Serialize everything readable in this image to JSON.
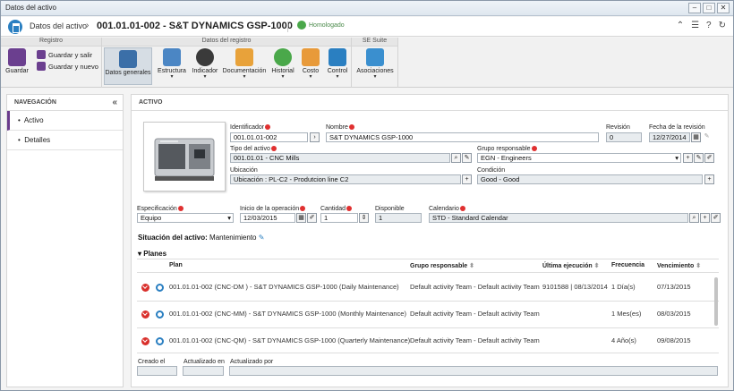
{
  "window": {
    "title": "Datos del activo",
    "buttons": [
      "–",
      "□",
      "✕"
    ]
  },
  "header": {
    "breadcrumb": "Datos del activo",
    "title": "001.01.01-002 - S&T DYNAMICS GSP-1000",
    "badge": "Homologado"
  },
  "ribbon": {
    "groups": [
      {
        "label": "Registro",
        "save": "Guardar",
        "save_exit": "Guardar y salir",
        "save_new": "Guardar y nuevo"
      },
      {
        "label": "Datos del registro",
        "buttons": [
          "Datos generales",
          "Estructura",
          "Indicador",
          "Documentación",
          "Historial",
          "Costo",
          "Control"
        ]
      },
      {
        "label": "SE Suite",
        "buttons": [
          "Asociaciones"
        ]
      }
    ],
    "dropdown_mark": "▾"
  },
  "nav": {
    "header": "NAVEGACIÓN",
    "items": [
      "Activo",
      "Detalles"
    ]
  },
  "panel": {
    "header": "ACTIVO"
  },
  "form": {
    "identificador": {
      "label": "Identificador",
      "value": "001.01.01-002"
    },
    "nombre": {
      "label": "Nombre",
      "value": "S&T DYNAMICS GSP-1000"
    },
    "revision": {
      "label": "Revisión",
      "value": "0"
    },
    "fecha_revision": {
      "label": "Fecha de la revisión",
      "value": "12/27/2014"
    },
    "tipo": {
      "label": "Tipo del activo",
      "value": "001.01.01 - CNC Mills"
    },
    "grupo": {
      "label": "Grupo responsable",
      "value": "EGN - Engineers"
    },
    "ubicacion": {
      "label": "Ubicación",
      "value": "Ubicación : PL-C2 - Produtcion line C2"
    },
    "condicion": {
      "label": "Condición",
      "value": "Good - Good"
    },
    "especificacion": {
      "label": "Especificación",
      "value": "Equipo"
    },
    "inicio": {
      "label": "Inicio de la operación",
      "value": "12/03/2015"
    },
    "cantidad": {
      "label": "Cantidad",
      "value": "1"
    },
    "disponible": {
      "label": "Disponible",
      "value": "1"
    },
    "calendario": {
      "label": "Calendario",
      "value": "STD - Standard Calendar"
    }
  },
  "status": {
    "label": "Situación del activo:",
    "value": "Mantenimiento"
  },
  "plans": {
    "title": "Planes",
    "columns": [
      "Plan",
      "Grupo responsable",
      "Última ejecución",
      "Frecuencia",
      "Vencimiento"
    ],
    "rows": [
      {
        "plan": "001.01.01-002 (CNC-DM ) - S&T DYNAMICS GSP-1000 (Daily Maintenance)",
        "grupo": "Default activity Team - Default activity Team",
        "ultima": "9101588 | 08/13/2014",
        "frecuencia": "1 Día(s)",
        "vencimiento": "07/13/2015"
      },
      {
        "plan": "001.01.01-002 (CNC-MM) - S&T DYNAMICS GSP-1000 (Monthly Maintenance)",
        "grupo": "Default activity Team - Default activity Team",
        "ultima": "",
        "frecuencia": "1 Mes(es)",
        "vencimiento": "08/03/2015"
      },
      {
        "plan": "001.01.01-002 (CNC-QM) - S&T DYNAMICS GSP-1000 (Quarterly Maintenance)",
        "grupo": "Default activity Team - Default activity Team",
        "ultima": "",
        "frecuencia": "4 Año(s)",
        "vencimiento": "09/08/2015"
      }
    ]
  },
  "footer": {
    "creado": "Creado el",
    "actualizado_en": "Actualizado en",
    "actualizado_por": "Actualizado por"
  },
  "colors": {
    "accent": "#2a7fc1",
    "nav_active": "#6a3b8c",
    "remove": "#d9302c",
    "homologado": "#4aa84a"
  }
}
